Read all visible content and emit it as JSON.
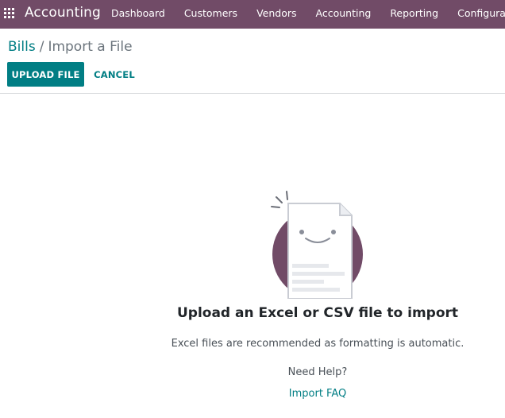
{
  "navbar": {
    "app_name": "Accounting",
    "menu": [
      {
        "label": "Dashboard"
      },
      {
        "label": "Customers"
      },
      {
        "label": "Vendors"
      },
      {
        "label": "Accounting"
      },
      {
        "label": "Reporting"
      },
      {
        "label": "Configuration"
      }
    ],
    "color": "#714b67"
  },
  "breadcrumb": {
    "parent": "Bills",
    "separator": "/",
    "current": "Import a File"
  },
  "actions": {
    "upload_label": "UPLOAD FILE",
    "cancel_label": "CANCEL"
  },
  "empty_state": {
    "title": "Upload an Excel or CSV file to import",
    "subtitle": "Excel files are recommended as formatting is automatic.",
    "help_label": "Need Help?",
    "faq_link": "Import FAQ",
    "icon": "smiling-document-icon"
  },
  "colors": {
    "primary": "#017e84",
    "brand": "#714b67"
  }
}
